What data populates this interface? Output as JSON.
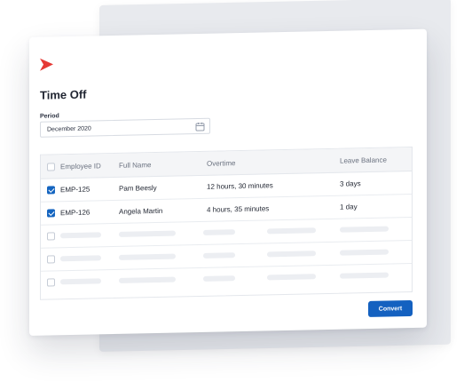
{
  "app": {
    "brand_color": "#e53935",
    "accent_color": "#1461c0"
  },
  "page": {
    "title": "Time Off"
  },
  "period": {
    "label": "Period",
    "value": "December 2020",
    "icon": "calendar-icon"
  },
  "table": {
    "columns": [
      "Employee ID",
      "Full Name",
      "Overtime",
      "Leave Balance"
    ],
    "rows": [
      {
        "checked": true,
        "employee_id": "EMP-125",
        "full_name": "Pam Beesly",
        "overtime": "12 hours, 30 minutes",
        "leave_balance": "3 days"
      },
      {
        "checked": true,
        "employee_id": "EMP-126",
        "full_name": "Angela Martin",
        "overtime": "4 hours, 35 minutes",
        "leave_balance": "1 day"
      }
    ],
    "placeholder_rows": 3
  },
  "actions": {
    "convert_label": "Convert"
  }
}
